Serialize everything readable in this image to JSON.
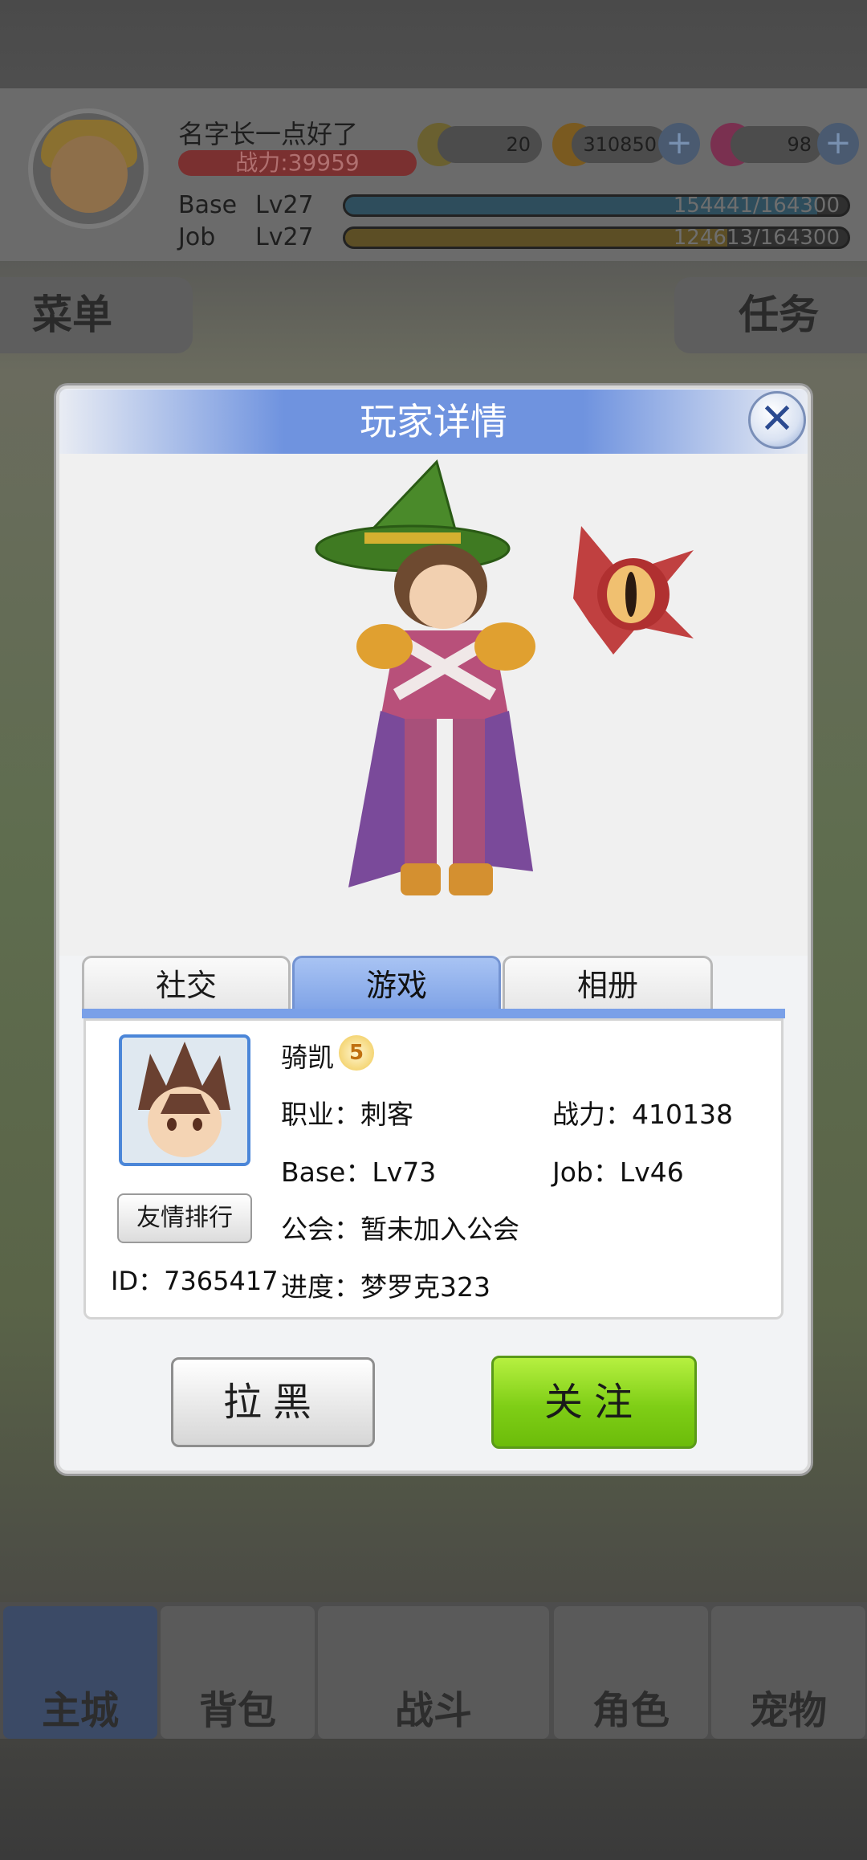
{
  "hud": {
    "player_name": "名字长一点好了",
    "power": "战力:39959",
    "currency_1": "20",
    "currency_2": "310850",
    "currency_3": "98",
    "base_label": "Base",
    "base_level": "Lv27",
    "base_exp": "154441/164300",
    "base_exp_fraction": 0.94,
    "job_label": "Job",
    "job_level": "Lv27",
    "job_exp": "124613/164300",
    "job_exp_fraction": 0.76,
    "menu_label": "菜单",
    "task_label": "任务"
  },
  "bottom_nav": {
    "tab_1": "主城",
    "tab_2": "背包",
    "tab_3": "战斗",
    "tab_4": "角色",
    "tab_5": "宠物"
  },
  "modal": {
    "title": "玩家详情",
    "tabs": [
      "社交",
      "游戏",
      "相册"
    ],
    "active_tab": "游戏",
    "name": "骑凯",
    "vip_level": "5",
    "job": "职业：刺客",
    "power": "战力：410138",
    "base": "Base：Lv73",
    "job_level": "Job：Lv46",
    "guild": "公会：暂未加入公会",
    "progress": "进度：梦罗克323",
    "friend_rank_button": "友情排行",
    "id": "ID：7365417",
    "block_button": "拉黑",
    "follow_button": "关注"
  },
  "colors": {
    "title_band": "#6f93df",
    "follow_green": "#7fce16",
    "portrait_border": "#4b86d8"
  }
}
